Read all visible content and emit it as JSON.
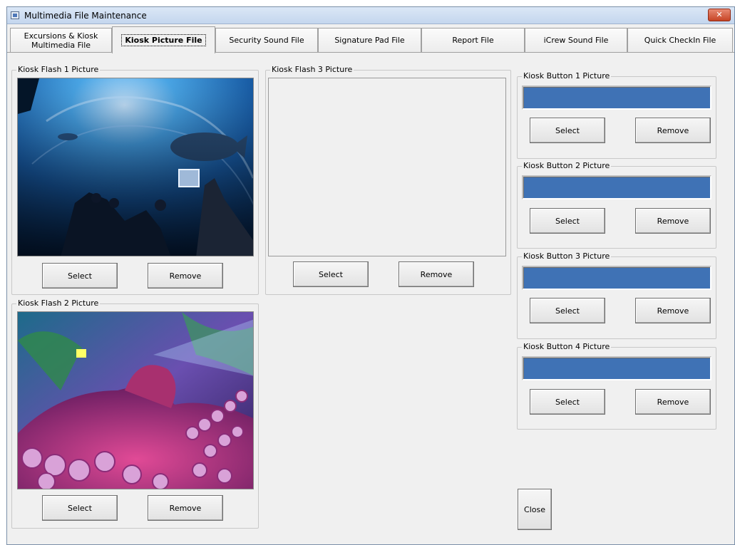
{
  "window": {
    "title": "Multimedia File Maintenance",
    "close_glyph": "✕"
  },
  "tabs": [
    {
      "label": "Excursions & Kiosk Multimedia File",
      "active": false
    },
    {
      "label": "Kiosk Picture File",
      "active": true
    },
    {
      "label": "Security Sound File",
      "active": false
    },
    {
      "label": "Signature Pad File",
      "active": false
    },
    {
      "label": "Report File",
      "active": false
    },
    {
      "label": "iCrew Sound File",
      "active": false
    },
    {
      "label": "Quick CheckIn File",
      "active": false
    }
  ],
  "flash1": {
    "title": "Kiosk Flash 1 Picture",
    "select": "Select",
    "remove": "Remove",
    "image": "aquarium-tunnel-photo"
  },
  "flash2": {
    "title": "Kiosk Flash 2 Picture",
    "select": "Select",
    "remove": "Remove",
    "image": "octopus-photo"
  },
  "flash3": {
    "title": "Kiosk Flash 3 Picture",
    "select": "Select",
    "remove": "Remove"
  },
  "buttons": [
    {
      "title": "Kiosk Button 1 Picture",
      "select": "Select",
      "remove": "Remove"
    },
    {
      "title": "Kiosk Button 2 Picture",
      "select": "Select",
      "remove": "Remove"
    },
    {
      "title": "Kiosk Button 3 Picture",
      "select": "Select",
      "remove": "Remove"
    },
    {
      "title": "Kiosk Button 4 Picture",
      "select": "Select",
      "remove": "Remove"
    }
  ],
  "close_label": "Close",
  "colors": {
    "button_preview": "#3f72b5",
    "title_bar": "#c4d6ee"
  }
}
